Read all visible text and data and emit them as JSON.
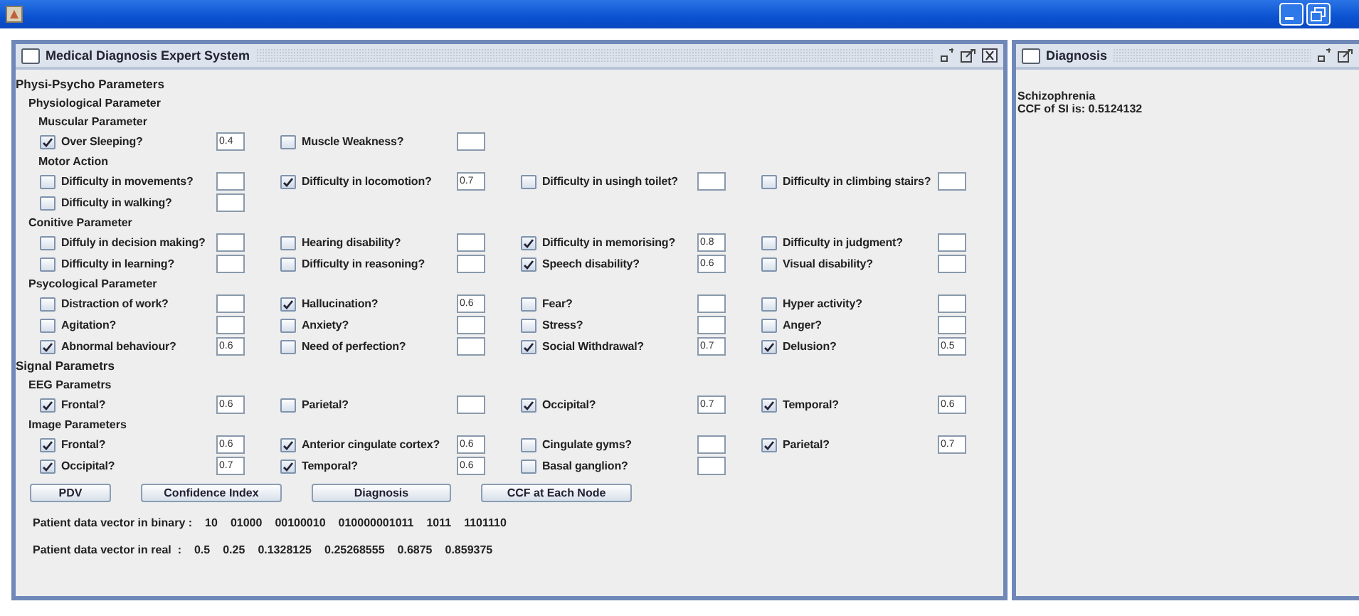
{
  "main_frame": {
    "title": "Medical Diagnosis Expert System",
    "sections": [
      {
        "title": "Physi-Psycho Parameters",
        "children": [
          {
            "title": "Physiological Parameter",
            "children": [
              {
                "title": "Muscular Parameter",
                "rows": [
                  [
                    {
                      "label": "Over Sleeping?",
                      "checked": true,
                      "value": "0.4"
                    },
                    {
                      "label": "Muscle Weakness?",
                      "checked": false
                    }
                  ]
                ]
              },
              {
                "title": "Motor Action",
                "rows": [
                  [
                    {
                      "label": "Difficulty in movements?",
                      "checked": false
                    },
                    {
                      "label": "Difficulty in locomotion?",
                      "checked": true,
                      "value": "0.7"
                    },
                    {
                      "label": "Difficulty in usingh toilet?",
                      "checked": false
                    },
                    {
                      "label": "Difficulty in climbing stairs?",
                      "checked": false
                    }
                  ],
                  [
                    {
                      "label": "Difficulty in walking?",
                      "checked": false
                    }
                  ]
                ]
              }
            ]
          },
          {
            "title": "Conitive  Parameter",
            "rows": [
              [
                {
                  "label": "Diffuly in decision making?",
                  "checked": false
                },
                {
                  "label": "Hearing disability?",
                  "checked": false
                },
                {
                  "label": "Difficulty in memorising?",
                  "checked": true,
                  "value": "0.8"
                },
                {
                  "label": "Difficulty in judgment?",
                  "checked": false
                }
              ],
              [
                {
                  "label": "Difficulty in learning?",
                  "checked": false
                },
                {
                  "label": "Difficulty in reasoning?",
                  "checked": false
                },
                {
                  "label": "Speech disability?",
                  "checked": true,
                  "value": "0.6"
                },
                {
                  "label": "Visual disability?",
                  "checked": false
                }
              ]
            ]
          },
          {
            "title": "Psycological Parameter",
            "rows": [
              [
                {
                  "label": "Distraction of work?",
                  "checked": false
                },
                {
                  "label": "Hallucination?",
                  "checked": true,
                  "value": "0.6"
                },
                {
                  "label": "Fear?",
                  "checked": false
                },
                {
                  "label": "Hyper activity?",
                  "checked": false
                }
              ],
              [
                {
                  "label": "Agitation?",
                  "checked": false
                },
                {
                  "label": "Anxiety?",
                  "checked": false
                },
                {
                  "label": "Stress?",
                  "checked": false
                },
                {
                  "label": "Anger?",
                  "checked": false
                }
              ],
              [
                {
                  "label": "Abnormal behaviour?",
                  "checked": true,
                  "value": "0.6"
                },
                {
                  "label": "Need of perfection?",
                  "checked": false
                },
                {
                  "label": "Social Withdrawal?",
                  "checked": true,
                  "value": "0.7"
                },
                {
                  "label": "Delusion?",
                  "checked": true,
                  "value": "0.5"
                }
              ]
            ]
          }
        ]
      },
      {
        "title": "Signal Parametrs",
        "children": [
          {
            "title": "EEG Parametrs",
            "rows": [
              [
                {
                  "label": "Frontal?",
                  "checked": true,
                  "value": "0.6"
                },
                {
                  "label": "Parietal?",
                  "checked": false
                },
                {
                  "label": "Occipital?",
                  "checked": true,
                  "value": "0.7"
                },
                {
                  "label": "Temporal?",
                  "checked": true,
                  "value": "0.6"
                }
              ]
            ]
          },
          {
            "title": "Image Parameters",
            "rows": [
              [
                {
                  "label": "Frontal?",
                  "checked": true,
                  "value": "0.6"
                },
                {
                  "label": "Anterior cingulate cortex?",
                  "checked": true,
                  "value": "0.6"
                },
                {
                  "label": "Cingulate gyms?",
                  "checked": false
                },
                {
                  "label": "Parietal?",
                  "checked": true,
                  "value": "0.7"
                }
              ],
              [
                {
                  "label": "Occipital?",
                  "checked": true,
                  "value": "0.7"
                },
                {
                  "label": "Temporal?",
                  "checked": true,
                  "value": "0.6"
                },
                {
                  "label": "Basal ganglion?",
                  "checked": false
                }
              ]
            ]
          }
        ]
      }
    ],
    "buttons": [
      "PDV",
      "Confidence Index",
      "Diagnosis",
      "CCF at Each Node"
    ],
    "outputs": [
      {
        "label": "Patient data vector in binary :",
        "values": [
          "10",
          "01000",
          "00100010",
          "010000001011",
          "1011",
          "1101110"
        ]
      },
      {
        "label": "Patient data vector in real  :",
        "values": [
          "0.5",
          "0.25",
          "0.1328125",
          "0.25268555",
          "0.6875",
          "0.859375"
        ]
      }
    ]
  },
  "diagnosis_frame": {
    "title": "Diagnosis",
    "lines": [
      "Schizophrenia",
      "CCF of SI is: 0.5124132"
    ]
  }
}
